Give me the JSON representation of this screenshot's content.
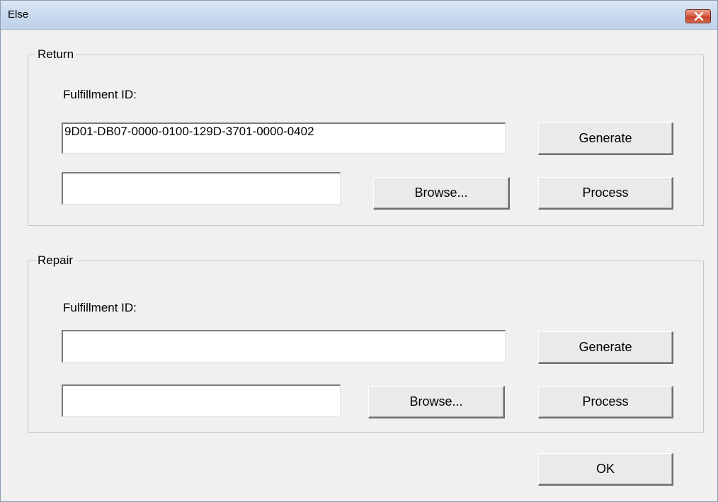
{
  "window": {
    "title": "Else"
  },
  "return_group": {
    "legend": "Return",
    "fulfillment_label": "Fulfillment ID:",
    "fulfillment_value": "9D01-DB07-0000-0100-129D-3701-0000-0402",
    "path_value": "",
    "generate_label": "Generate",
    "browse_label": "Browse...",
    "process_label": "Process"
  },
  "repair_group": {
    "legend": "Repair",
    "fulfillment_label": "Fulfillment ID:",
    "fulfillment_value": "",
    "path_value": "",
    "generate_label": "Generate",
    "browse_label": "Browse...",
    "process_label": "Process"
  },
  "ok_label": "OK",
  "colors": {
    "titlebar": "#c9d9ee",
    "dialog_bg": "#f0f0f0",
    "close_button": "#d8624a"
  },
  "icons": {
    "close": "close-icon"
  }
}
